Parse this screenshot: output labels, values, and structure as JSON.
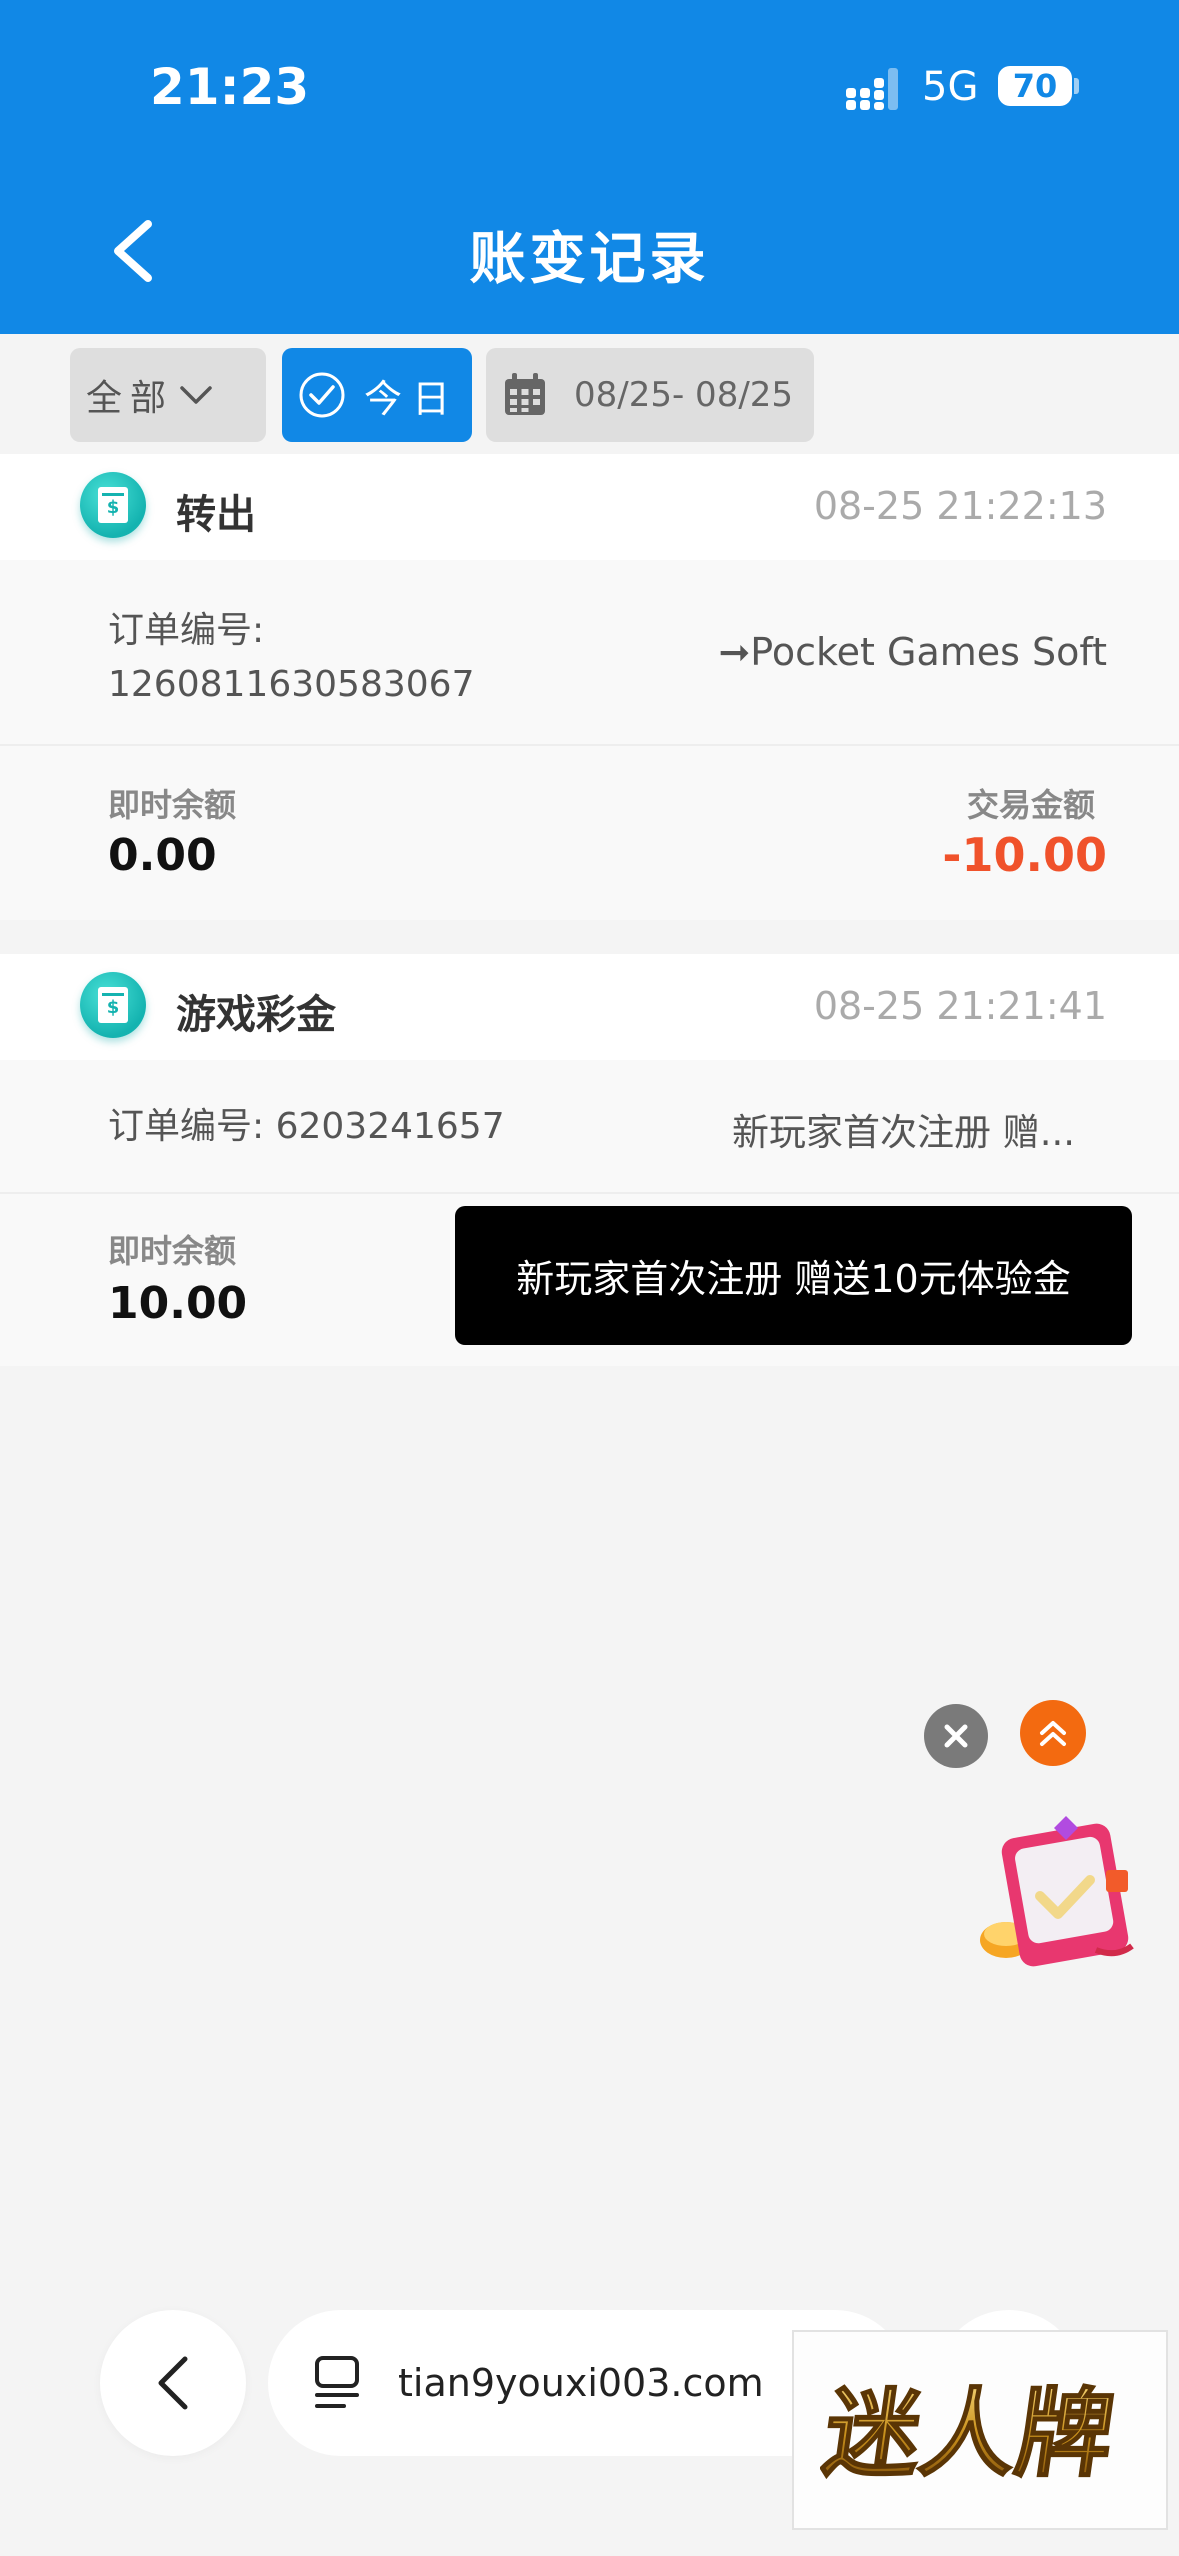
{
  "status_bar": {
    "time": "21:23",
    "network": "5G",
    "battery": "70"
  },
  "header": {
    "title": "账变记录"
  },
  "filters": {
    "all_label": "全部",
    "today_label": "今日",
    "date_range": "08/25- 08/25"
  },
  "records": [
    {
      "type": "转出",
      "time": "08-25 21:22:13",
      "order_label": "订单编号:",
      "order_no": "1260811630583067",
      "destination": "➞Pocket Games Soft",
      "balance_label": "即时余额",
      "balance": "0.00",
      "amount_label": "交易金额",
      "amount": "-10.00"
    },
    {
      "type": "游戏彩金",
      "time": "08-25 21:21:41",
      "order_text": "订单编号: 6203241657",
      "description": "新玩家首次注册 赠...",
      "balance_label": "即时余额",
      "balance": "10.00"
    }
  ],
  "toast": "新玩家首次注册 赠送10元体验金",
  "browser": {
    "url": "tian9youxi003.com"
  },
  "watermark": "迷人牌",
  "colors": {
    "primary": "#1188e6",
    "negative": "#f0522b",
    "fab_orange": "#f36a10"
  }
}
